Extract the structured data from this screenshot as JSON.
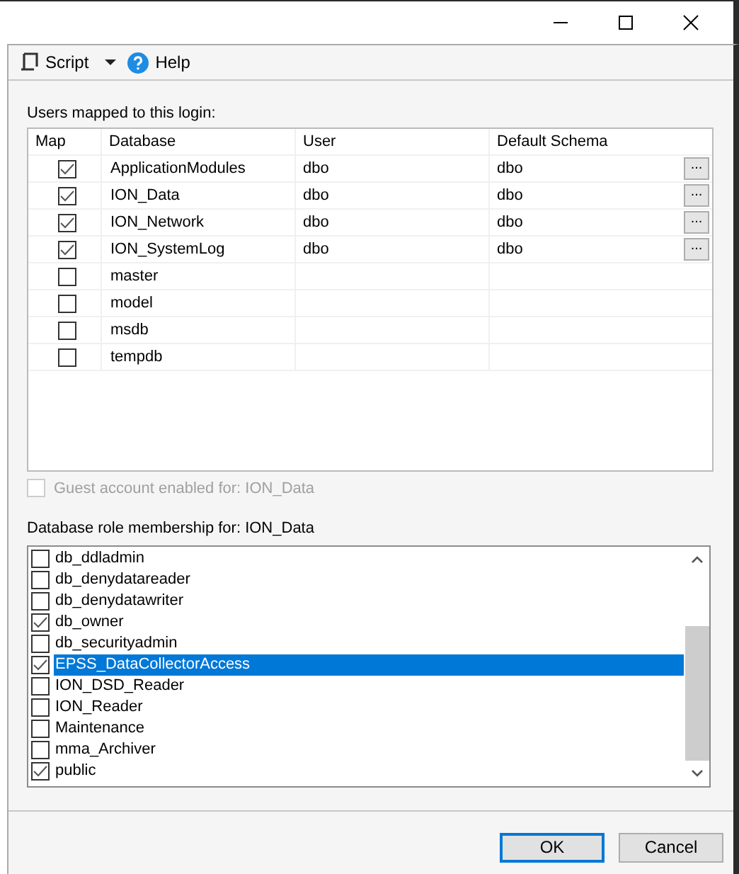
{
  "toolbar": [
    {
      "kind": "script",
      "label": "Script",
      "dropdown": true
    },
    {
      "kind": "help",
      "label": "Help",
      "dropdown": false
    }
  ],
  "users_mapped": {
    "label": "Users mapped to this login:",
    "columns": [
      "Map",
      "Database",
      "User",
      "Default Schema"
    ],
    "rows": [
      {
        "map": true,
        "database": "ApplicationModules",
        "user": "dbo",
        "default_schema": "dbo",
        "schema_button": "..."
      },
      {
        "map": true,
        "database": "ION_Data",
        "user": "dbo",
        "default_schema": "dbo",
        "schema_button": "..."
      },
      {
        "map": true,
        "database": "ION_Network",
        "user": "dbo",
        "default_schema": "dbo",
        "schema_button": "..."
      },
      {
        "map": true,
        "database": "ION_SystemLog",
        "user": "dbo",
        "default_schema": "dbo",
        "schema_button": "..."
      },
      {
        "map": false,
        "database": "master"
      },
      {
        "map": false,
        "database": "model"
      },
      {
        "map": false,
        "database": "msdb"
      },
      {
        "map": false,
        "database": "tempdb"
      }
    ]
  },
  "guest": {
    "label": "Guest account enabled for: ION_Data",
    "checked": false,
    "disabled": true
  },
  "roles": {
    "label": "Database role membership for: ION_Data",
    "items": [
      {
        "name": "db_ddladmin",
        "checked": false,
        "selected": false
      },
      {
        "name": "db_denydatareader",
        "checked": false,
        "selected": false
      },
      {
        "name": "db_denydatawriter",
        "checked": false,
        "selected": false
      },
      {
        "name": "db_owner",
        "checked": true,
        "selected": false
      },
      {
        "name": "db_securityadmin",
        "checked": false,
        "selected": false
      },
      {
        "name": "EPSS_DataCollectorAccess",
        "checked": true,
        "selected": true
      },
      {
        "name": "ION_DSD_Reader",
        "checked": false,
        "selected": false
      },
      {
        "name": "ION_Reader",
        "checked": false,
        "selected": false
      },
      {
        "name": "Maintenance",
        "checked": false,
        "selected": false
      },
      {
        "name": "mma_Archiver",
        "checked": false,
        "selected": false
      },
      {
        "name": "public",
        "checked": true,
        "selected": false
      }
    ]
  },
  "buttons": [
    {
      "label": "OK",
      "default": true
    },
    {
      "label": "Cancel",
      "default": false
    }
  ]
}
